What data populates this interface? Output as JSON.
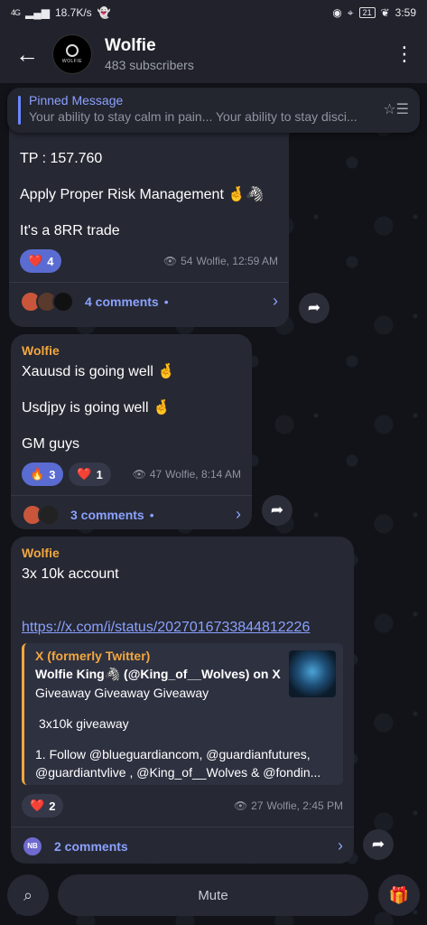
{
  "status_bar": {
    "signal": "4G",
    "speed": "18.7K/s",
    "battery": "21",
    "time": "3:59"
  },
  "header": {
    "title": "Wolfie",
    "subtitle": "483 subscribers",
    "avatar_text": "WOLFIE"
  },
  "pinned": {
    "title": "Pinned Message",
    "text": "Your ability to stay calm in pain... Your ability to stay disci..."
  },
  "messages": [
    {
      "lines": [
        "TP : 157.760",
        "Apply Proper Risk Management 🤞🦓",
        "It's a 8RR trade"
      ],
      "reactions": [
        {
          "emoji": "❤️",
          "count": "4"
        }
      ],
      "views": "54",
      "meta": "Wolfie, 12:59 AM",
      "comments": "4 comments"
    },
    {
      "author": "Wolfie",
      "lines": [
        "Xauusd is going well 🤞",
        "Usdjpy is going well 🤞",
        "GM guys"
      ],
      "reactions": [
        {
          "emoji": "🔥",
          "count": "3"
        },
        {
          "emoji": "❤️",
          "count": "1"
        }
      ],
      "views": "47",
      "meta": "Wolfie, 8:14 AM",
      "comments": "3 comments"
    },
    {
      "author": "Wolfie",
      "lines": [
        "3x 10k account"
      ],
      "link": "https://x.com/i/status/2027016733844812226",
      "preview": {
        "site": "X (formerly Twitter)",
        "title": "Wolfie King🦓 (@King_of__Wolves) on X",
        "line1": "Giveaway Giveaway Giveaway",
        "line2": "3x10k giveaway",
        "line3": "1. Follow @blueguardiancom, @guardianfutures,",
        "line4": "@guardiantvlive ,  @King_of__Wolves & @fondin..."
      },
      "reactions": [
        {
          "emoji": "❤️",
          "count": "2"
        }
      ],
      "views": "27",
      "meta": "Wolfie, 2:45 PM",
      "comments": "2 comments",
      "commenter_initials": "NB"
    }
  ],
  "bottom": {
    "mute_label": "Mute"
  },
  "colors": {
    "accent": "#8aa2ff",
    "author": "#f3a73f",
    "bubble": "#262833",
    "reaction_selected": "#5a6bd1"
  }
}
